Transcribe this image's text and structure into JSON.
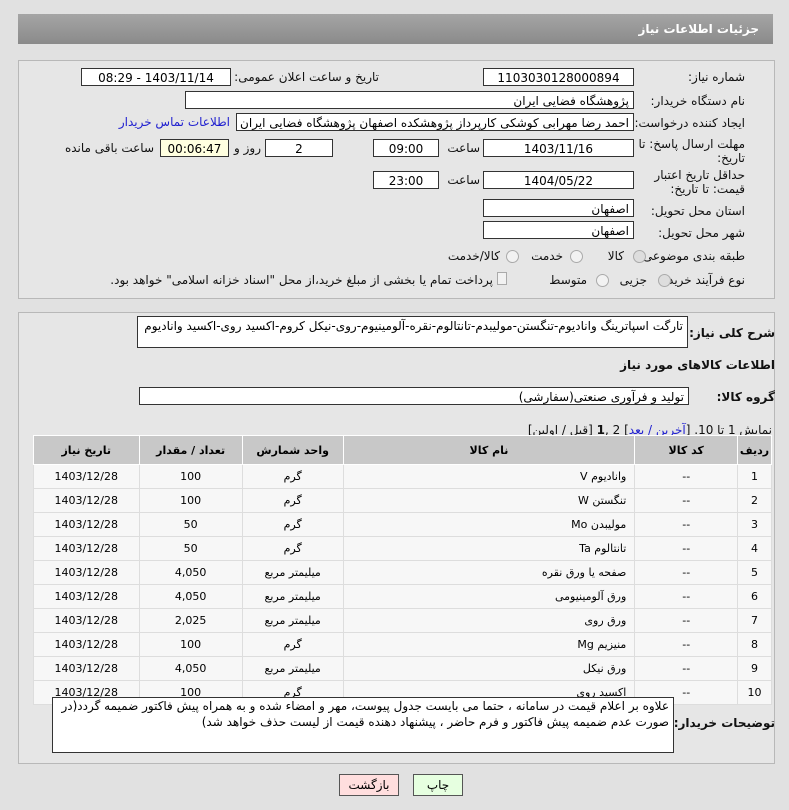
{
  "header": {
    "title": "جزئیات اطلاعات نیاز"
  },
  "form": {
    "need_no_label": "شماره نیاز:",
    "need_no": "1103030128000894",
    "announce_label": "تاریخ و ساعت اعلان عمومی:",
    "announce": "1403/11/14 - 08:29",
    "buyer_label": "نام دستگاه خریدار:",
    "buyer": "پژوهشگاه فضایی ایران",
    "creator_label": "ایجاد کننده درخواست:",
    "creator": "احمد رضا مهرابی کوشکی کارپرداز پژوهشکده اصفهان پژوهشگاه فضایی ایران",
    "contact_link": "اطلاعات تماس خریدار",
    "deadline_label": "مهلت ارسال پاسخ: تا تاریخ:",
    "deadline_date": "1403/11/16",
    "time_label": "ساعت",
    "deadline_time": "09:00",
    "days": "2",
    "days_label": "روز و",
    "remaining": "00:06:47",
    "remaining_label": "ساعت باقی مانده",
    "validity_label": "حداقل تاریخ اعتبار قیمت: تا تاریخ:",
    "validity_date": "1404/05/22",
    "validity_time": "23:00",
    "province_label": "استان محل تحویل:",
    "province": "اصفهان",
    "city_label": "شهر محل تحویل:",
    "city": "اصفهان",
    "category_label": "طبقه بندی موضوعی:",
    "cat_options": [
      "کالا",
      "خدمت",
      "کالا/خدمت"
    ],
    "process_label": "نوع فرآیند خرید :",
    "proc_options": [
      "جزیی",
      "متوسط"
    ],
    "payment_note": "پرداخت تمام یا بخشی از مبلغ خرید،از محل \"اسناد خزانه اسلامی\" خواهد بود."
  },
  "desc": {
    "label": "شرح کلی نیاز:",
    "value": "تارگت اسپاترینگ وانادیوم-تنگستن-مولیبدم-تانتالوم-نقره-آلومینیوم-روی-نیکل کروم-اکسید روی-اکسید وانادیوم"
  },
  "goods": {
    "title": "اطلاعات کالاهای مورد نیاز",
    "group_label": "گروه کالا:",
    "group": "تولید و فرآوری صنعتی(سفارشی)",
    "paging_prefix": "نمایش 1 تا 10. [",
    "paging_links": "آخرین / بعد",
    "paging_mid": "] 2 ,",
    "paging_cur": "1",
    "paging_suffix": " [قبل / اولین]",
    "columns": [
      "ردیف",
      "کد کالا",
      "نام کالا",
      "واحد شمارش",
      "تعداد / مقدار",
      "تاریخ نیاز"
    ],
    "rows": [
      [
        "1",
        "--",
        "وانادیوم V",
        "گرم",
        "100",
        "1403/12/28"
      ],
      [
        "2",
        "--",
        "تنگستن W",
        "گرم",
        "100",
        "1403/12/28"
      ],
      [
        "3",
        "--",
        "مولیبدن Mo",
        "گرم",
        "50",
        "1403/12/28"
      ],
      [
        "4",
        "--",
        "تانتالوم Ta",
        "گرم",
        "50",
        "1403/12/28"
      ],
      [
        "5",
        "--",
        "صفحه یا ورق نقره",
        "میلیمتر مربع",
        "4,050",
        "1403/12/28"
      ],
      [
        "6",
        "--",
        "ورق آلومینیومی",
        "میلیمتر مربع",
        "4,050",
        "1403/12/28"
      ],
      [
        "7",
        "--",
        "ورق روی",
        "میلیمتر مربع",
        "2,025",
        "1403/12/28"
      ],
      [
        "8",
        "--",
        "منیزیم Mg",
        "گرم",
        "100",
        "1403/12/28"
      ],
      [
        "9",
        "--",
        "ورق نیکل",
        "میلیمتر مربع",
        "4,050",
        "1403/12/28"
      ],
      [
        "10",
        "--",
        "اکسید روی",
        "گرم",
        "100",
        "1403/12/28"
      ]
    ]
  },
  "notes": {
    "label": "توضیحات خریدار:",
    "value": "علاوه بر اعلام قیمت در سامانه ، حتما می بایست جدول پیوست، مهر و امضاء شده و به همراه پیش فاکتور ضمیمه گردد(در صورت عدم ضمیمه پیش فاکتور و فرم حاضر ، پیشنهاد دهنده قیمت از لیست حذف خواهد شد)"
  },
  "buttons": {
    "print": "چاپ",
    "back": "بازگشت"
  }
}
